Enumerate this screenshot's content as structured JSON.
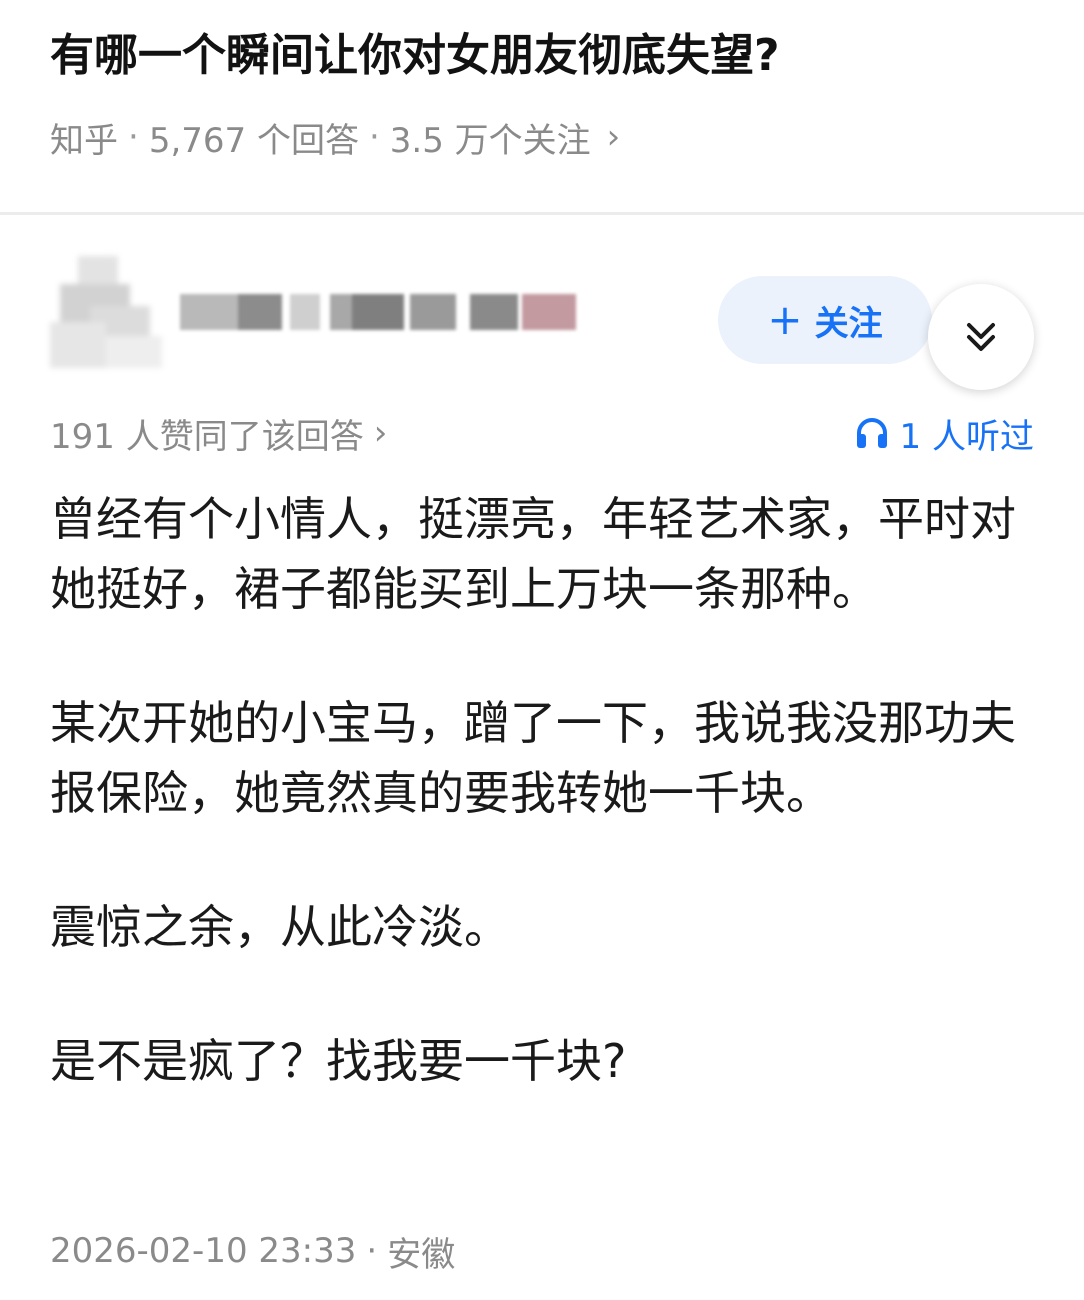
{
  "question": {
    "title": "有哪一个瞬间让你对女朋友彻底失望?",
    "source": "知乎",
    "separator": "·",
    "answer_count": "5,767 个回答",
    "follower_count": "3.5 万个关注",
    "chevron": "›"
  },
  "author": {
    "avatar_icon": "avatar-blurred",
    "follow_label": "关注",
    "follow_icon": "plus-icon",
    "expand_icon": "double-chevron-down-icon"
  },
  "answer": {
    "likes_text": "191 人赞同了该回答",
    "likes_chevron": "›",
    "listened_icon": "headphones-icon",
    "listened_text": "1 人听过",
    "paragraphs": [
      "曾经有个小情人，挺漂亮，年轻艺术家，平时对她挺好，裙子都能买到上万块一条那种。",
      "某次开她的小宝马，蹭了一下，我说我没那功夫报保险，她竟然真的要我转她一千块。",
      "震惊之余，从此冷淡。",
      "是不是疯了？找我要一千块?"
    ],
    "timestamp": "2026-02-10 23:33",
    "location": "安徽"
  },
  "colors": {
    "accent": "#1772f6",
    "follow_bg": "#ebf2fc",
    "muted_text": "#8a8a8a",
    "divider": "#ececec"
  }
}
